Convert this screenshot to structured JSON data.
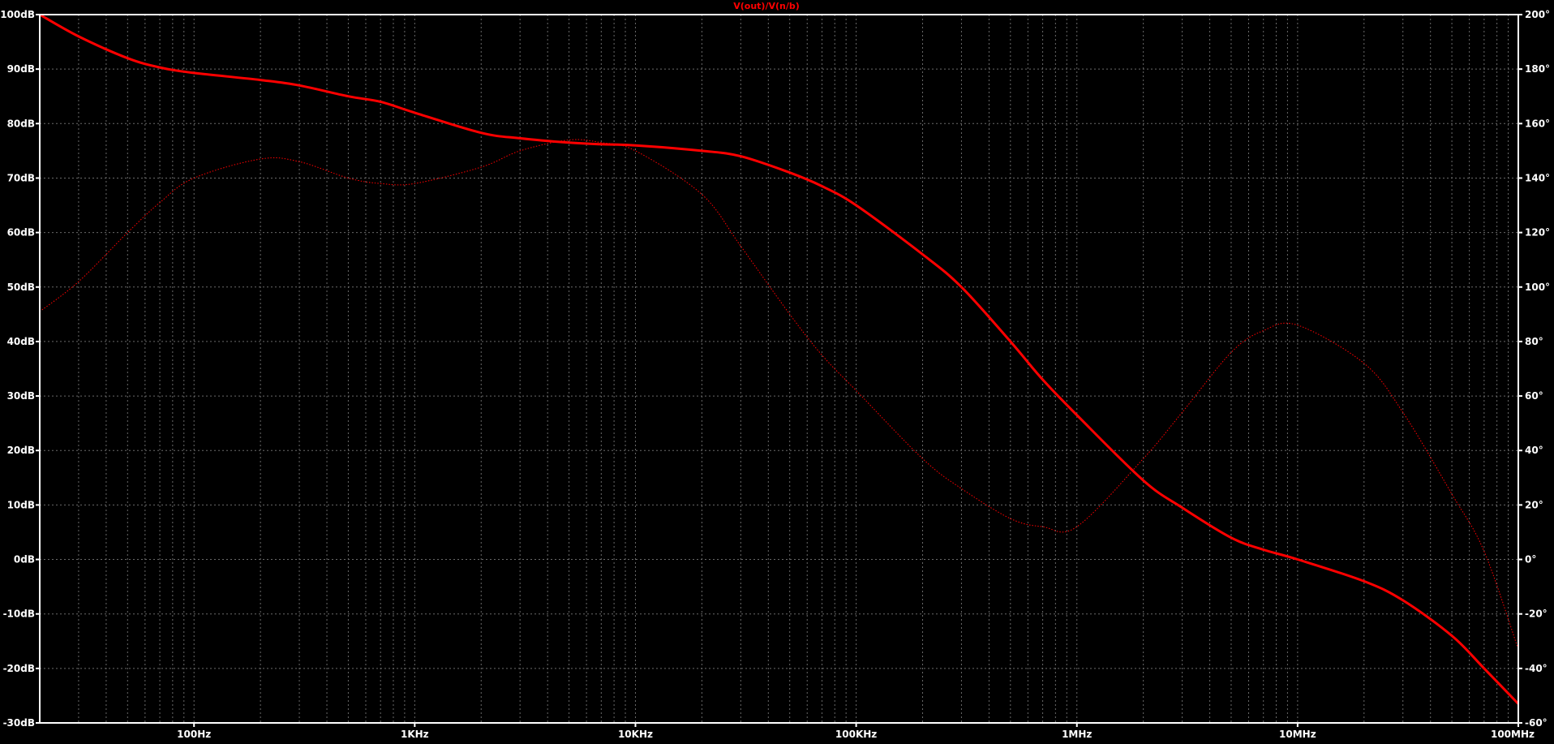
{
  "chart_data": {
    "type": "line",
    "title": "V(out)/V(n/b)",
    "x_scale": "log",
    "xlim": [
      20,
      100000000
    ],
    "x_ticks": [
      {
        "value": 100,
        "label": "100Hz"
      },
      {
        "value": 1000,
        "label": "1KHz"
      },
      {
        "value": 10000,
        "label": "10KHz"
      },
      {
        "value": 100000,
        "label": "100KHz"
      },
      {
        "value": 1000000,
        "label": "1MHz"
      },
      {
        "value": 10000000,
        "label": "10MHz"
      },
      {
        "value": 100000000,
        "label": "100MHz"
      }
    ],
    "ylim_left": [
      -30,
      100
    ],
    "y_ticks_left": [
      {
        "value": 100,
        "label": "100dB"
      },
      {
        "value": 90,
        "label": "90dB"
      },
      {
        "value": 80,
        "label": "80dB"
      },
      {
        "value": 70,
        "label": "70dB"
      },
      {
        "value": 60,
        "label": "60dB"
      },
      {
        "value": 50,
        "label": "50dB"
      },
      {
        "value": 40,
        "label": "40dB"
      },
      {
        "value": 30,
        "label": "30dB"
      },
      {
        "value": 20,
        "label": "20dB"
      },
      {
        "value": 10,
        "label": "10dB"
      },
      {
        "value": 0,
        "label": "0dB"
      },
      {
        "value": -10,
        "label": "-10dB"
      },
      {
        "value": -20,
        "label": "-20dB"
      },
      {
        "value": -30,
        "label": "-30dB"
      }
    ],
    "ylim_right": [
      -60,
      200
    ],
    "y_ticks_right": [
      {
        "value": 200,
        "label": "200°"
      },
      {
        "value": 180,
        "label": "180°"
      },
      {
        "value": 160,
        "label": "160°"
      },
      {
        "value": 140,
        "label": "140°"
      },
      {
        "value": 120,
        "label": "120°"
      },
      {
        "value": 100,
        "label": "100°"
      },
      {
        "value": 80,
        "label": "80°"
      },
      {
        "value": 60,
        "label": "60°"
      },
      {
        "value": 40,
        "label": "40°"
      },
      {
        "value": 20,
        "label": "20°"
      },
      {
        "value": 0,
        "label": "0°"
      },
      {
        "value": -20,
        "label": "-20°"
      },
      {
        "value": -40,
        "label": "-40°"
      },
      {
        "value": -60,
        "label": "-60°"
      }
    ],
    "grid": true,
    "colors": {
      "background": "#000000",
      "trace": "#ff0000",
      "grid": "#6a6a6a",
      "axis": "#ffffff"
    },
    "series": [
      {
        "axis": "left",
        "style": "solid",
        "x": [
          20,
          30,
          50,
          70,
          100,
          200,
          300,
          500,
          700,
          1000,
          2000,
          3000,
          5000,
          7000,
          10000,
          20000,
          30000,
          50000,
          70000,
          100000,
          200000,
          300000,
          500000,
          700000,
          1000000,
          2000000,
          3000000,
          5000000,
          7000000,
          10000000,
          20000000,
          30000000,
          50000000,
          70000000,
          100000000
        ],
        "y": [
          100,
          96,
          92,
          90.3,
          89.3,
          88,
          87,
          85,
          84,
          82,
          78.3,
          77.3,
          76.5,
          76.2,
          76,
          75,
          74,
          71,
          68.5,
          65,
          56,
          50,
          40,
          33,
          26.5,
          14.5,
          9.5,
          4,
          1.8,
          0,
          -4,
          -7.5,
          -14,
          -20,
          -26.5
        ]
      },
      {
        "axis": "right",
        "style": "dotted",
        "x": [
          20,
          30,
          50,
          70,
          100,
          200,
          300,
          500,
          700,
          1000,
          2000,
          3000,
          5000,
          7000,
          10000,
          20000,
          30000,
          50000,
          70000,
          100000,
          200000,
          300000,
          500000,
          700000,
          1000000,
          2000000,
          3000000,
          5000000,
          7000000,
          10000000,
          20000000,
          30000000,
          50000000,
          70000000,
          100000000
        ],
        "y": [
          91,
          102,
          120,
          131,
          140,
          147,
          146,
          140,
          138,
          138,
          144,
          150,
          154,
          153,
          150,
          134,
          115,
          90,
          75,
          62,
          37,
          26,
          15,
          12,
          12,
          37,
          54,
          76,
          84,
          86,
          72,
          54,
          24,
          3,
          -33
        ]
      }
    ]
  }
}
